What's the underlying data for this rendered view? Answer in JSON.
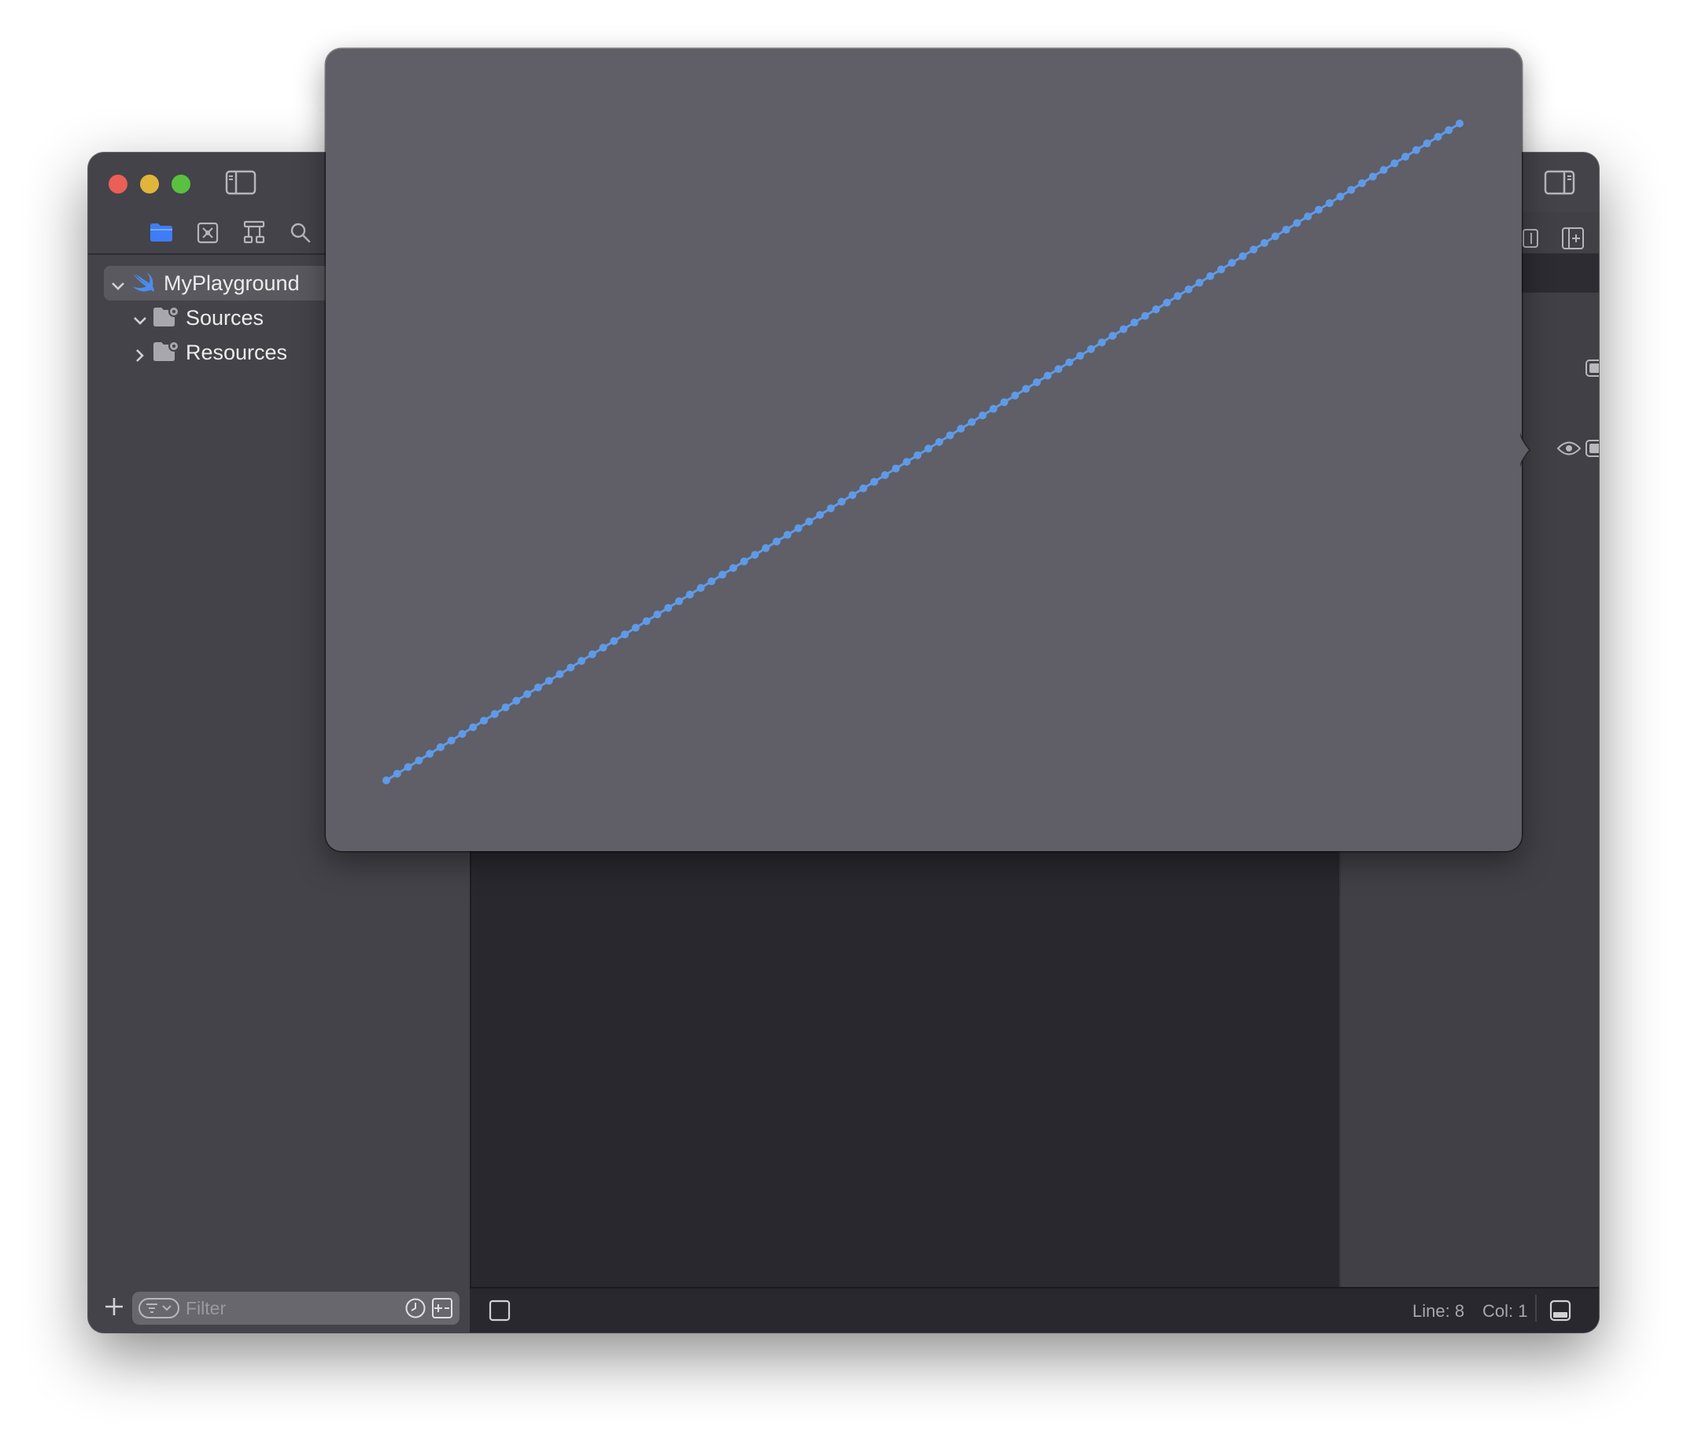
{
  "window": {
    "controls": {
      "close": "close-icon",
      "minimize": "minimize-icon",
      "zoom": "zoom-icon"
    },
    "left_toggle_icon": "sidebar-left-icon",
    "right_toggle_icon": "sidebar-right-icon"
  },
  "navigator": {
    "tabs": [
      {
        "icon": "folder-icon",
        "active": true
      },
      {
        "icon": "source-control-icon",
        "active": false
      },
      {
        "icon": "hierarchy-icon",
        "active": false
      },
      {
        "icon": "search-icon",
        "active": false
      }
    ],
    "tree": [
      {
        "label": "MyPlayground",
        "icon": "swift-icon",
        "expanded": true,
        "selected": true
      },
      {
        "label": "Sources",
        "icon": "folder-gear-icon",
        "expanded": true,
        "selected": false
      },
      {
        "label": "Resources",
        "icon": "folder-gear-icon",
        "expanded": false,
        "selected": false
      }
    ],
    "filter": {
      "placeholder": "Filter"
    }
  },
  "status_bar": {
    "line_label": "Line: 8",
    "col_label": "Col: 1"
  },
  "colors": {
    "accent": "#3e7df5",
    "series": "#5e9ae8",
    "popover_bg": "#605e66",
    "editor_bg": "#29282e",
    "sidebar_bg": "#44434a"
  },
  "chart_data": {
    "type": "line",
    "x": [
      0,
      1,
      2,
      3,
      4,
      5,
      6,
      7,
      8,
      9,
      10,
      11,
      12,
      13,
      14,
      15,
      16,
      17,
      18,
      19,
      20,
      21,
      22,
      23,
      24,
      25,
      26,
      27,
      28,
      29,
      30,
      31,
      32,
      33,
      34,
      35,
      36,
      37,
      38,
      39,
      40,
      41,
      42,
      43,
      44,
      45,
      46,
      47,
      48,
      49,
      50,
      51,
      52,
      53,
      54,
      55,
      56,
      57,
      58,
      59,
      60,
      61,
      62,
      63,
      64,
      65,
      66,
      67,
      68,
      69,
      70,
      71,
      72,
      73,
      74,
      75,
      76,
      77,
      78,
      79,
      80,
      81,
      82,
      83,
      84,
      85,
      86,
      87,
      88,
      89,
      90,
      91,
      92,
      93,
      94,
      95,
      96,
      97,
      98,
      99
    ],
    "series": [
      {
        "values": [
          0,
          1,
          2,
          3,
          4,
          5,
          6,
          7,
          8,
          9,
          10,
          11,
          12,
          13,
          14,
          15,
          16,
          17,
          18,
          19,
          20,
          21,
          22,
          23,
          24,
          25,
          26,
          27,
          28,
          29,
          30,
          31,
          32,
          33,
          34,
          35,
          36,
          37,
          38,
          39,
          40,
          41,
          42,
          43,
          44,
          45,
          46,
          47,
          48,
          49,
          50,
          51,
          52,
          53,
          54,
          55,
          56,
          57,
          58,
          59,
          60,
          61,
          62,
          63,
          64,
          65,
          66,
          67,
          68,
          69,
          70,
          71,
          72,
          73,
          74,
          75,
          76,
          77,
          78,
          79,
          80,
          81,
          82,
          83,
          84,
          85,
          86,
          87,
          88,
          89,
          90,
          91,
          92,
          93,
          94,
          95,
          96,
          97,
          98,
          99
        ]
      }
    ],
    "markers": true,
    "grid": false,
    "legend": "none",
    "xlim": [
      0,
      99
    ],
    "ylim": [
      0,
      99
    ]
  }
}
